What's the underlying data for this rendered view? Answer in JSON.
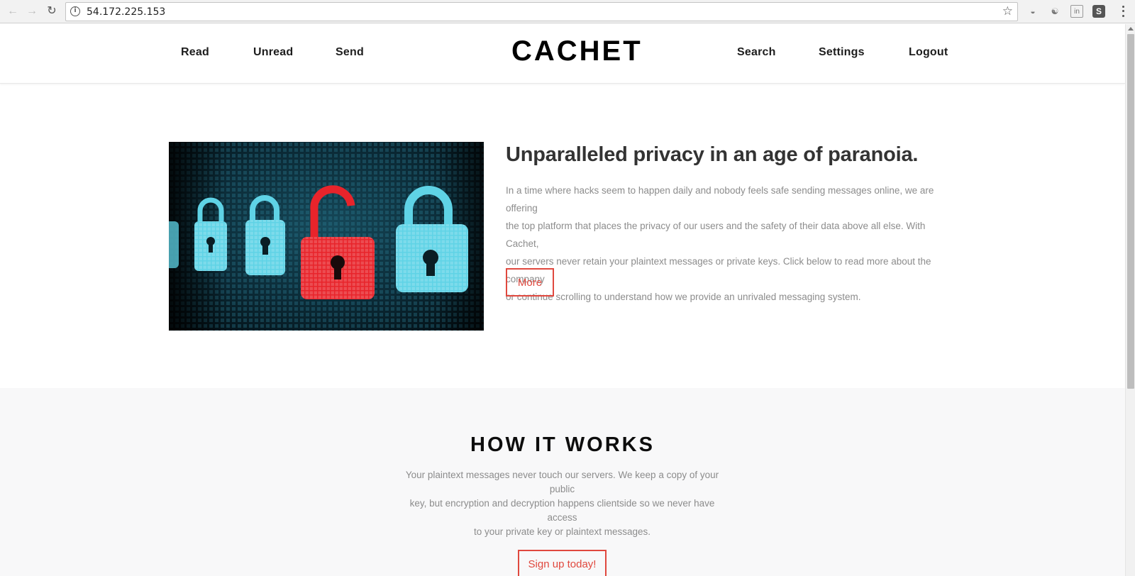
{
  "browser": {
    "url": "54.172.225.153",
    "back_icon": "arrow-left-icon",
    "forward_icon": "arrow-right-icon",
    "reload_icon": "reload-icon",
    "info_icon": "info-icon",
    "bookmark_icon": "star-icon",
    "menu_icon": "kebab-menu-icon",
    "extensions": [
      {
        "name": "ublock-icon",
        "glyph": "◒"
      },
      {
        "name": "ghostery-icon",
        "glyph": "☯"
      },
      {
        "name": "linkedin-icon",
        "glyph": "in"
      },
      {
        "name": "s-extension-icon",
        "glyph": "S"
      }
    ]
  },
  "header": {
    "logo": "CACHET",
    "nav_left": [
      "Read",
      "Unread",
      "Send"
    ],
    "nav_right": [
      "Search",
      "Settings",
      "Logout"
    ]
  },
  "hero": {
    "image_alt": "padlocks",
    "title": "Unparalleled privacy in an age of paranoia.",
    "lines": [
      "In a time where hacks seem to happen daily and nobody feels safe sending messages online, we are offering",
      "the top platform that places the privacy of our users and the safety of their data above all else. With Cachet,",
      "our servers never retain your plaintext messages or private keys. Click below to read more about the company",
      "or continue scrolling to understand how we provide an unrivaled messaging system."
    ],
    "button": "More"
  },
  "how_it_works": {
    "title": "HOW IT WORKS",
    "lines": [
      "Your plaintext messages never touch our servers. We keep a copy of your public",
      "key, but encryption and decryption happens clientside so we never have access",
      "to your private key or plaintext messages."
    ],
    "button": "Sign up today!"
  },
  "colors": {
    "accent": "#e0483e",
    "body_text": "#8c8c8c",
    "heading": "#333333",
    "section_bg": "#f8f8f9",
    "lock_blue": "#5fd3e6",
    "lock_red": "#e8242b"
  }
}
